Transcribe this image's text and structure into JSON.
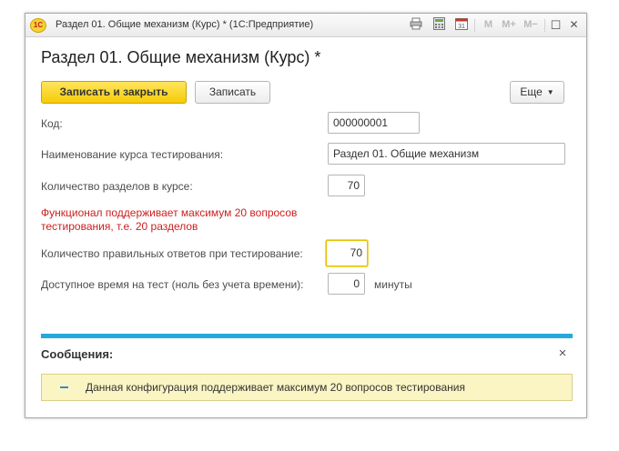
{
  "window": {
    "app_logo": "1С",
    "title": "Раздел 01. Общие механизм (Курс) * (1С:Предприятие)",
    "toolbar_icons": [
      "print-icon",
      "calculator-icon",
      "calendar-icon"
    ],
    "calendar_day": "31",
    "memory_buttons": [
      "M",
      "M+",
      "M−"
    ],
    "maximize_glyph": "☐",
    "close_glyph": "✕"
  },
  "form": {
    "heading": "Раздел 01. Общие механизм (Курс) *",
    "buttons": {
      "save_close": "Записать и закрыть",
      "save": "Записать",
      "more": "Еще",
      "more_caret": "▼"
    },
    "fields": {
      "code": {
        "label": "Код:",
        "value": "000000001"
      },
      "name": {
        "label": "Наименование курса тестирования:",
        "value": "Раздел 01. Общие механизм"
      },
      "sections": {
        "label": "Количество разделов в курсе:",
        "value": "70"
      },
      "correct": {
        "label": "Количество правильных ответов при тестирование:",
        "value": "70"
      },
      "time": {
        "label": "Доступное время на тест (ноль без учета времени):",
        "value": "0",
        "suffix": "минуты"
      }
    },
    "warning": "Функционал поддерживает максимум 20 вопросов тестирования, т.е. 20 разделов"
  },
  "messages": {
    "title": "Сообщения:",
    "close_glyph": "×",
    "items": [
      "Данная конфигурация поддерживает максимум 20 вопросов тестирования"
    ]
  },
  "colors": {
    "primary_button": "#f5cc08",
    "warning_text": "#cc1f1f",
    "messages_bar": "#25a8dc",
    "message_background": "#fbf5c4"
  }
}
